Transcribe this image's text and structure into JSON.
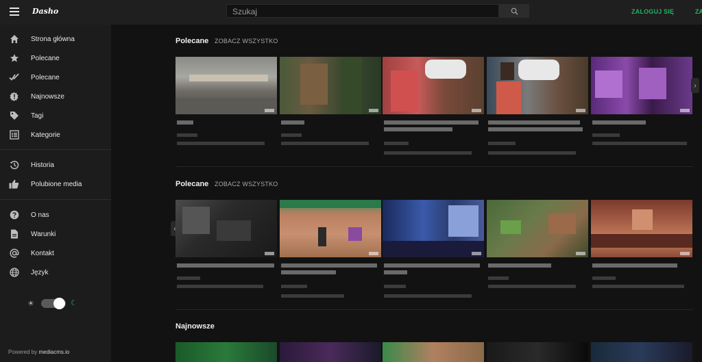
{
  "header": {
    "logo": "Dasho",
    "search_placeholder": "Szukaj",
    "login_label": "ZALOGUJ SIĘ",
    "register_label": "ZARE"
  },
  "sidebar": {
    "items": [
      {
        "label": "Strona główna",
        "icon": "home-icon"
      },
      {
        "label": "Polecane",
        "icon": "star-icon"
      },
      {
        "label": "Polecane",
        "icon": "check-icon"
      },
      {
        "label": "Najnowsze",
        "icon": "badge-icon"
      },
      {
        "label": "Tagi",
        "icon": "tag-icon"
      },
      {
        "label": "Kategorie",
        "icon": "list-icon"
      },
      {
        "label": "Historia",
        "icon": "history-icon"
      },
      {
        "label": "Polubione media",
        "icon": "thumb-up-icon"
      },
      {
        "label": "O nas",
        "icon": "help-icon"
      },
      {
        "label": "Warunki",
        "icon": "document-icon"
      },
      {
        "label": "Kontakt",
        "icon": "at-icon"
      },
      {
        "label": "Język",
        "icon": "globe-icon"
      }
    ],
    "theme_dark": true,
    "powered_prefix": "Powered by ",
    "powered_link": "mediacms.io"
  },
  "sections": [
    {
      "title": "Polecane",
      "see_all": "ZOBACZ WSZYSTKO"
    },
    {
      "title": "Polecane",
      "see_all": "ZOBACZ WSZYSTKO"
    },
    {
      "title": "Najnowsze"
    }
  ],
  "colors": {
    "accent": "#22b35e",
    "background": "#121212",
    "sidebar": "#1c1c1c"
  }
}
